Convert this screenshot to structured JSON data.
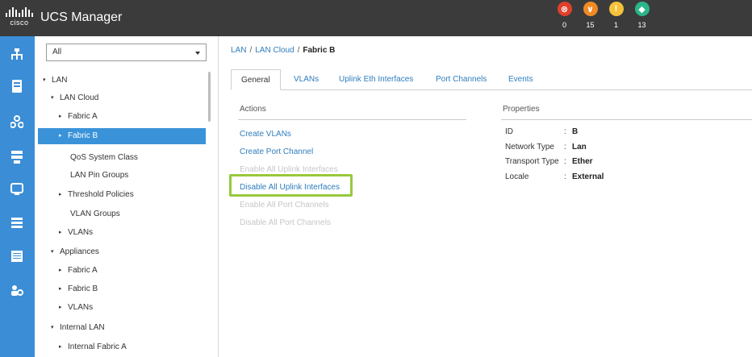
{
  "header": {
    "logo_word": "cisco",
    "app_title": "UCS Manager",
    "faults": [
      {
        "icon": "critical-x-icon",
        "symbol": "⊗",
        "color": "#e0412b",
        "count": "0"
      },
      {
        "icon": "major-chevron-icon",
        "symbol": "∨",
        "color": "#f08a24",
        "count": "15"
      },
      {
        "icon": "minor-warning-icon",
        "symbol": "!",
        "color": "#f5c23a",
        "count": "1"
      },
      {
        "icon": "warning-diamond-icon",
        "symbol": "◆",
        "color": "#2bb58a",
        "count": "13"
      }
    ]
  },
  "rail": {
    "color": "#3b8ed6",
    "items": [
      "network-icon",
      "server-icon",
      "lan-icon",
      "storage-icon",
      "vm-icon",
      "admin-icon",
      "chassis-icon",
      "equipment-icon"
    ]
  },
  "tree": {
    "filter_value": "All",
    "nodes": [
      {
        "label": "LAN",
        "arrow": "▾",
        "selected": false
      },
      {
        "label": "LAN Cloud",
        "arrow": "▾",
        "selected": false
      },
      {
        "label": "Fabric A",
        "arrow": "▸",
        "selected": false
      },
      {
        "label": "Fabric B",
        "arrow": "▸",
        "selected": true
      },
      {
        "label": "QoS System Class",
        "arrow": "",
        "selected": false
      },
      {
        "label": "LAN Pin Groups",
        "arrow": "",
        "selected": false
      },
      {
        "label": "Threshold Policies",
        "arrow": "▸",
        "selected": false
      },
      {
        "label": "VLAN Groups",
        "arrow": "",
        "selected": false
      },
      {
        "label": "VLANs",
        "arrow": "▸",
        "selected": false
      },
      {
        "label": "Appliances",
        "arrow": "▾",
        "selected": false
      },
      {
        "label": "Fabric A",
        "arrow": "▸",
        "selected": false
      },
      {
        "label": "Fabric B",
        "arrow": "▸",
        "selected": false
      },
      {
        "label": "VLANs",
        "arrow": "▸",
        "selected": false
      },
      {
        "label": "Internal LAN",
        "arrow": "▾",
        "selected": false
      },
      {
        "label": "Internal Fabric A",
        "arrow": "▸",
        "selected": false
      }
    ]
  },
  "breadcrumb": {
    "items": [
      "LAN",
      "LAN Cloud"
    ],
    "separator": "/",
    "current": "Fabric B"
  },
  "tabs": [
    {
      "label": "General",
      "active": true
    },
    {
      "label": "VLANs",
      "active": false
    },
    {
      "label": "Uplink Eth Interfaces",
      "active": false
    },
    {
      "label": "Port Channels",
      "active": false
    },
    {
      "label": "Events",
      "active": false
    }
  ],
  "actions": {
    "title": "Actions",
    "items": [
      {
        "label": "Create VLANs",
        "enabled": true
      },
      {
        "label": "Create Port Channel",
        "enabled": true
      },
      {
        "label": "Enable All Uplink Interfaces",
        "enabled": false
      },
      {
        "label": "Disable All Uplink Interfaces",
        "enabled": true
      },
      {
        "label": "Enable All Port Channels",
        "enabled": false
      },
      {
        "label": "Disable All Port Channels",
        "enabled": false
      }
    ]
  },
  "properties": {
    "title": "Properties",
    "items": [
      {
        "label": "ID",
        "value": "B"
      },
      {
        "label": "Network Type",
        "value": "Lan"
      },
      {
        "label": "Transport Type",
        "value": "Ether"
      },
      {
        "label": "Locale",
        "value": "External"
      }
    ]
  }
}
